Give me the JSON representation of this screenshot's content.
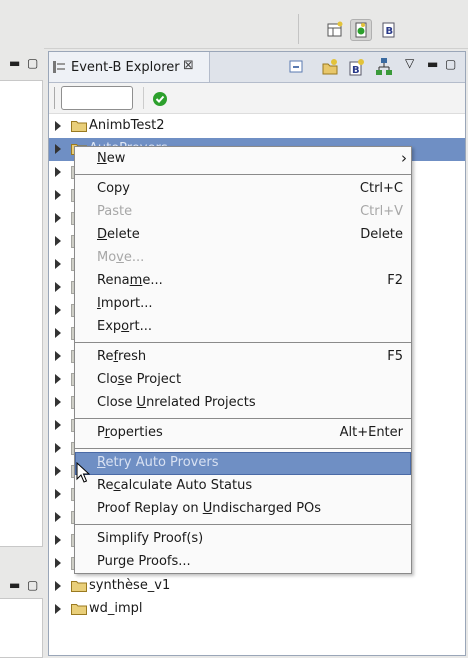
{
  "explorer": {
    "tab_title": "Event-B Explorer",
    "filter_value": "",
    "tree": [
      {
        "label": "AnimbTest2"
      },
      {
        "label": "AutoProvers"
      },
      {
        "label": "synthèse_v1"
      },
      {
        "label": "wd_impl"
      }
    ]
  },
  "menu": {
    "items": [
      {
        "label": "New",
        "mnemonic": "N",
        "accel": "",
        "submenu": true
      },
      {
        "label": "Copy",
        "accel": "Ctrl+C"
      },
      {
        "label": "Paste",
        "accel": "Ctrl+V",
        "disabled": true
      },
      {
        "label": "Delete",
        "mnemonic": "D",
        "accel": "Delete"
      },
      {
        "label": "Move...",
        "mnemonic": "v",
        "accel": "",
        "disabled": true
      },
      {
        "label": "Rename...",
        "mnemonic": "m",
        "accel": "F2"
      },
      {
        "label": "Import...",
        "mnemonic": "I",
        "accel": ""
      },
      {
        "label": "Export...",
        "mnemonic": "o",
        "accel": ""
      },
      {
        "label": "Refresh",
        "mnemonic": "f",
        "accel": "F5"
      },
      {
        "label": "Close Project",
        "mnemonic": "s",
        "accel": ""
      },
      {
        "label": "Close Unrelated Projects",
        "mnemonic": "U",
        "accel": ""
      },
      {
        "label": "Properties",
        "mnemonic": "r",
        "accel": "Alt+Enter"
      },
      {
        "label": "Retry Auto Provers",
        "mnemonic": "R",
        "accel": "",
        "highlighted": true
      },
      {
        "label": "Recalculate Auto Status",
        "mnemonic": "c",
        "accel": ""
      },
      {
        "label": "Proof Replay on Undischarged POs",
        "mnemonic": "U",
        "accel": ""
      },
      {
        "label": "Simplify Proof(s)",
        "accel": ""
      },
      {
        "label": "Purge Proofs...",
        "accel": ""
      }
    ]
  },
  "colors": {
    "selection": "#6f8fc4",
    "menu_bg": "#fafafa",
    "disabled_text": "#a7a7a7"
  },
  "icons": [
    "open-type-icon",
    "event-b-perspective-icon",
    "b-icon",
    "collapse-all-icon",
    "new-project-icon",
    "new-component-icon",
    "hierarchy-icon",
    "view-menu-icon",
    "minimize-icon",
    "maximize-icon",
    "close-tab-icon",
    "apply-filter-icon",
    "folder-icon",
    "mouse-pointer-icon"
  ]
}
